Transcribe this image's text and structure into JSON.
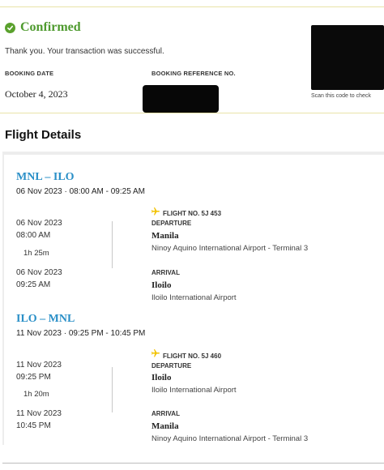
{
  "confirmation": {
    "status": "Confirmed",
    "message": "Thank you. Your transaction was successful.",
    "booking_date_label": "BOOKING DATE",
    "booking_date": "October 4, 2023",
    "booking_reference_label": "BOOKING REFERENCE NO.",
    "qr_caption": "Scan this code to check",
    "status_color": "#4e9a2e"
  },
  "section_title": "Flight Details",
  "flights": [
    {
      "route": "MNL – ILO",
      "date_line": "06 Nov 2023 · 08:00 AM - 09:25 AM",
      "departure_date": "06 Nov 2023",
      "departure_time": "08:00 AM",
      "duration": "1h 25m",
      "arrival_date": "06 Nov 2023",
      "arrival_time": "09:25 AM",
      "flight_no": "FLIGHT NO. 5J 453",
      "departure_label": "DEPARTURE",
      "departure_city": "Manila",
      "departure_airport": "Ninoy Aquino International Airport - Terminal 3",
      "arrival_label": "ARRIVAL",
      "arrival_city": "Iloilo",
      "arrival_airport": "Iloilo International Airport"
    },
    {
      "route": "ILO – MNL",
      "date_line": "11 Nov 2023 · 09:25 PM - 10:45 PM",
      "departure_date": "11 Nov 2023",
      "departure_time": "09:25 PM",
      "duration": "1h 20m",
      "arrival_date": "11 Nov 2023",
      "arrival_time": "10:45 PM",
      "flight_no": "FLIGHT NO. 5J 460",
      "departure_label": "DEPARTURE",
      "departure_city": "Iloilo",
      "departure_airport": "Iloilo International Airport",
      "arrival_label": "ARRIVAL",
      "arrival_city": "Manila",
      "arrival_airport": "Ninoy Aquino International Airport - Terminal 3"
    }
  ],
  "icons": {
    "status": "check-circle-icon",
    "flight": "airplane-icon"
  },
  "colors": {
    "route": "#2a8fc7",
    "plane": "#f2c200"
  }
}
